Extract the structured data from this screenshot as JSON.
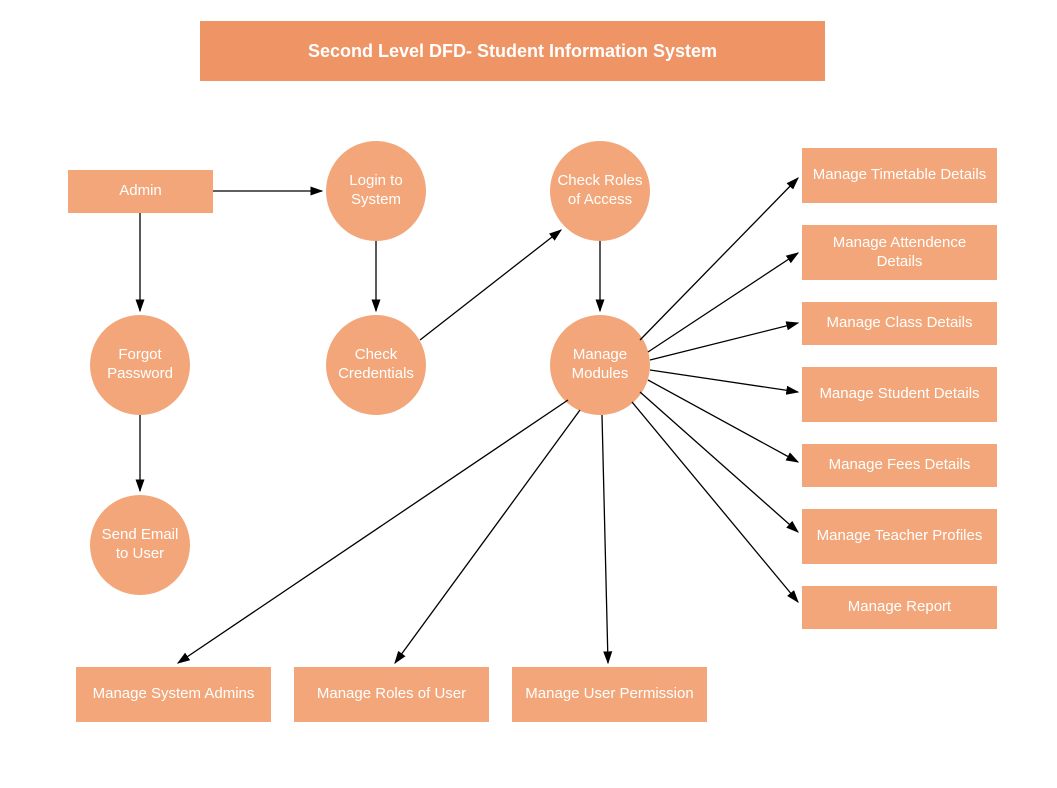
{
  "title": "Second Level DFD- Student Information System",
  "nodes": {
    "admin": "Admin",
    "login": "Login to System",
    "check_roles": "Check Roles of Access",
    "forgot_password": "Forgot Password",
    "check_credentials": "Check Credentials",
    "manage_modules": "Manage Modules",
    "send_email": "Send Email to User",
    "manage_system_admins": "Manage System Admins",
    "manage_roles_user": "Manage Roles of User",
    "manage_user_permission": "Manage User Permission",
    "manage_timetable": "Manage Timetable Details",
    "manage_attendence": "Manage Attendence Details",
    "manage_class": "Manage Class Details",
    "manage_student": "Manage Student Details",
    "manage_fees": "Manage Fees Details",
    "manage_teacher": "Manage Teacher Profiles",
    "manage_report": "Manage Report"
  },
  "edges": [
    [
      "admin",
      "login"
    ],
    [
      "admin",
      "forgot_password"
    ],
    [
      "login",
      "check_credentials"
    ],
    [
      "check_credentials",
      "check_roles"
    ],
    [
      "check_roles",
      "manage_modules"
    ],
    [
      "forgot_password",
      "send_email"
    ],
    [
      "manage_modules",
      "manage_timetable"
    ],
    [
      "manage_modules",
      "manage_attendence"
    ],
    [
      "manage_modules",
      "manage_class"
    ],
    [
      "manage_modules",
      "manage_student"
    ],
    [
      "manage_modules",
      "manage_fees"
    ],
    [
      "manage_modules",
      "manage_teacher"
    ],
    [
      "manage_modules",
      "manage_report"
    ],
    [
      "manage_modules",
      "manage_system_admins"
    ],
    [
      "manage_modules",
      "manage_roles_user"
    ],
    [
      "manage_modules",
      "manage_user_permission"
    ]
  ]
}
